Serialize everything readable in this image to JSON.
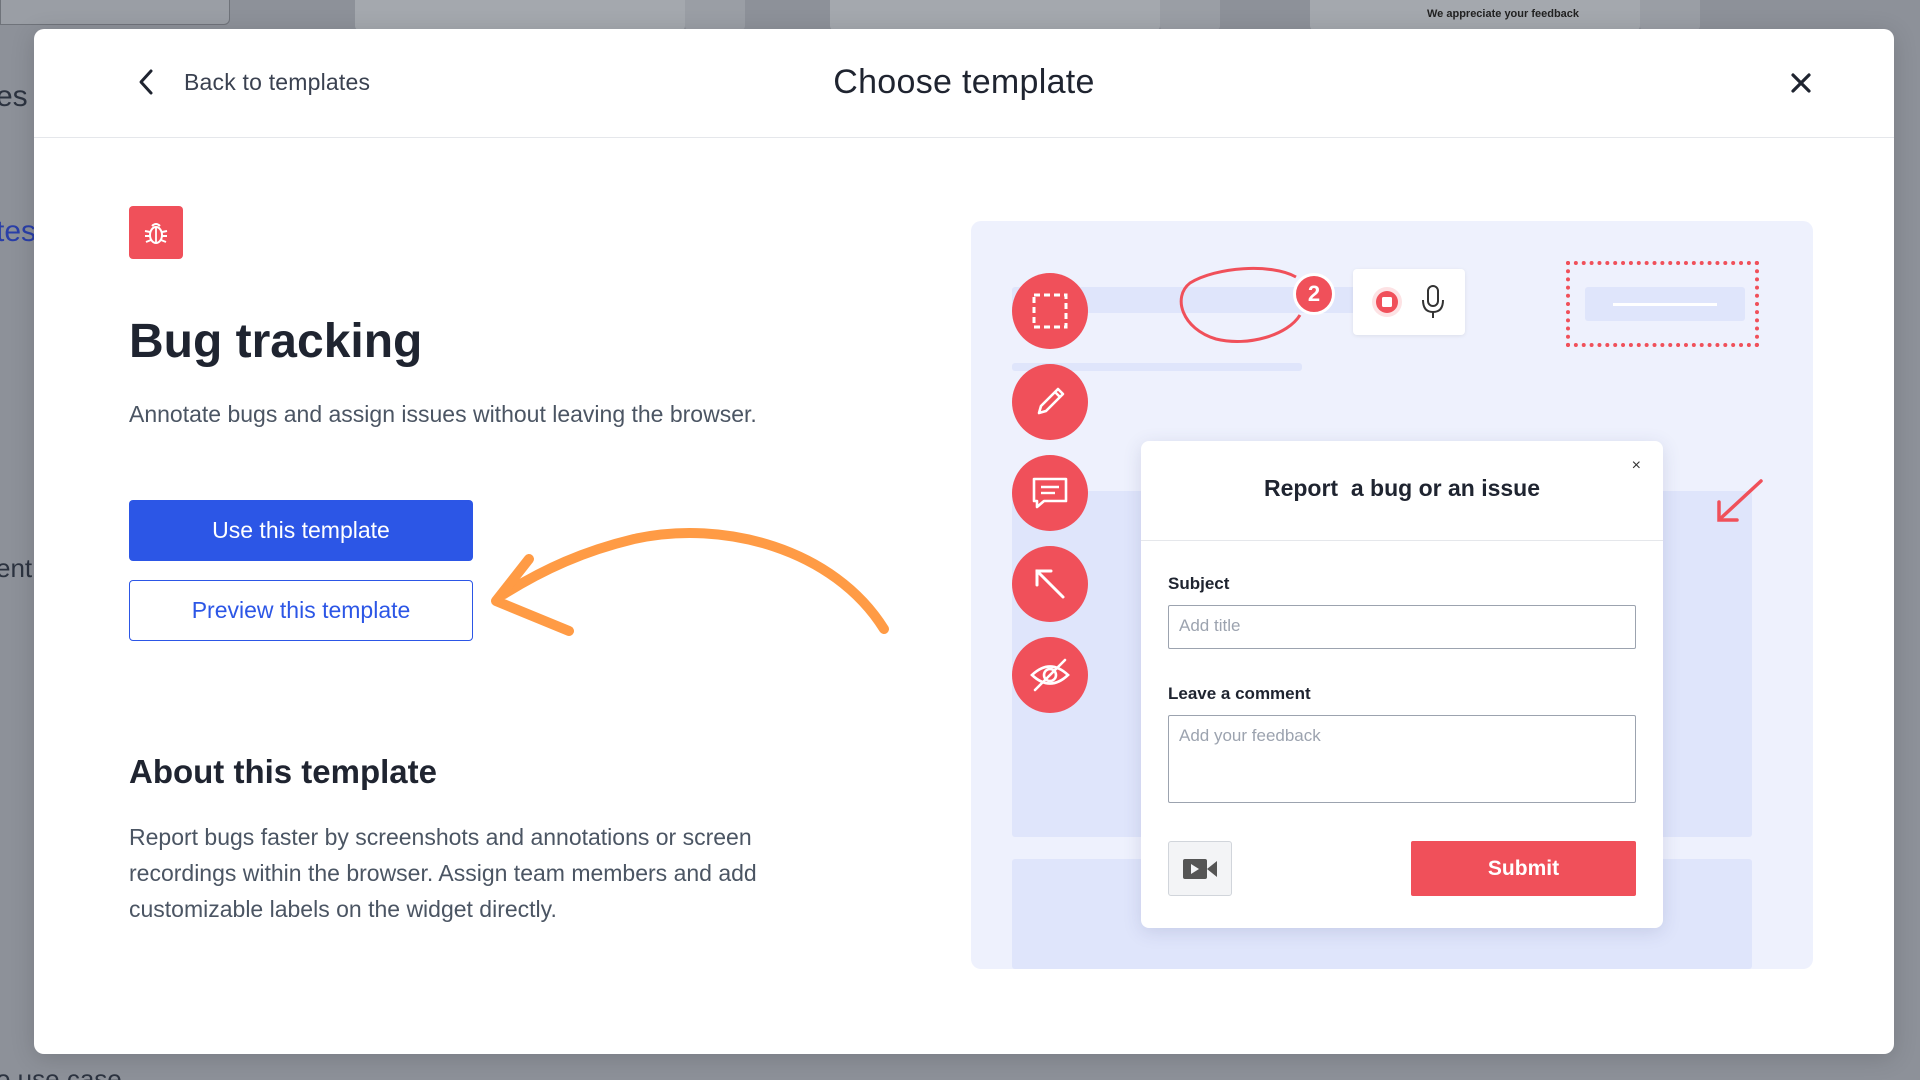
{
  "background": {
    "fragments": [
      "es",
      "tes",
      "ent",
      "o use case"
    ],
    "banner_text": "We appreciate your feedback"
  },
  "modal": {
    "back_label": "Back to templates",
    "title": "Choose template"
  },
  "template": {
    "icon": "bug-icon",
    "title": "Bug tracking",
    "description": "Annotate bugs and assign issues without leaving the browser.",
    "use_label": "Use this template",
    "preview_label": "Preview this template",
    "about_title": "About this template",
    "about_text": "Report bugs faster by screenshots and annotations or screen recordings within the browser. Assign team members and add customizable labels on the widget directly."
  },
  "illustration": {
    "badge_count": "2",
    "tools": [
      "select-area-icon",
      "pencil-icon",
      "comment-icon",
      "arrow-icon",
      "hide-icon"
    ],
    "dialog": {
      "title": "Report  a bug or an issue",
      "close_label": "×",
      "subject_label": "Subject",
      "subject_placeholder": "Add title",
      "comment_label": "Leave a comment",
      "comment_placeholder": "Add your feedback",
      "submit_label": "Submit"
    }
  },
  "colors": {
    "primary": "#2c56e6",
    "accent_red": "#f0505a",
    "arrow_orange": "#ff9b45",
    "illustration_bg": "#eef1fd"
  }
}
